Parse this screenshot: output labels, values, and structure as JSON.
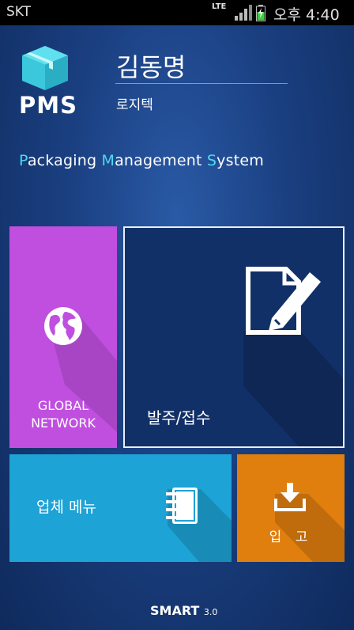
{
  "status_bar": {
    "carrier": "SKT",
    "network": "LTE",
    "time": "오후 4:40"
  },
  "header": {
    "app_logo_text": "PMS",
    "user_name": "김동명",
    "company": "로지텍"
  },
  "tagline": {
    "p1": "P",
    "w1": "ackaging ",
    "p2": "M",
    "w2": "anagement ",
    "p3": "S",
    "w3": "ystem"
  },
  "tiles": {
    "global_network": {
      "line1": "GLOBAL",
      "line2": "NETWORK",
      "color": "#c04fe0"
    },
    "order_receipt": {
      "label": "발주/접수",
      "color": "#123068"
    },
    "vendor_menu": {
      "label": "업체 메뉴",
      "color": "#1da3d6"
    },
    "inbound": {
      "label": "입 고",
      "color": "#e07e0e"
    }
  },
  "footer": {
    "brand": "SMART",
    "version": "3.0"
  },
  "colors": {
    "accent": "#4fd8f0",
    "background": "#1a3f80"
  },
  "icons": [
    "package-box-icon",
    "globe-icon",
    "document-edit-icon",
    "notebook-icon",
    "download-tray-icon",
    "signal-icon",
    "battery-icon"
  ]
}
